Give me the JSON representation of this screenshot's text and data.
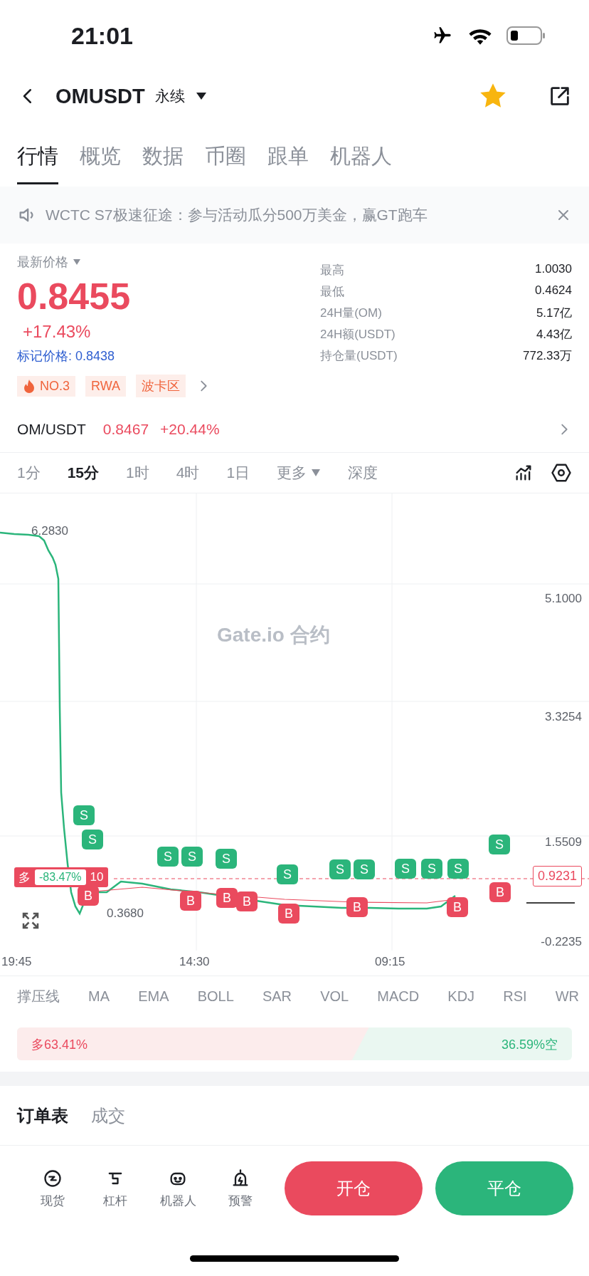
{
  "status_bar": {
    "time": "21:01"
  },
  "header": {
    "symbol": "OMUSDT",
    "contract_type": "永续",
    "favorite": true
  },
  "tabs": [
    {
      "label": "行情",
      "selected": true
    },
    {
      "label": "概览",
      "selected": false
    },
    {
      "label": "数据",
      "selected": false
    },
    {
      "label": "币圈",
      "selected": false
    },
    {
      "label": "跟单",
      "selected": false
    },
    {
      "label": "机器人",
      "selected": false
    }
  ],
  "announcement": {
    "text": "WCTC S7极速征途：参与活动瓜分500万美金，赢GT跑车"
  },
  "price": {
    "label": "最新价格",
    "value": "0.8455",
    "change": "+17.43%",
    "mark_price": "标记价格: 0.8438"
  },
  "tags": [
    {
      "kind": "hot",
      "label": "NO.3"
    },
    {
      "kind": "plain",
      "label": "RWA"
    },
    {
      "kind": "plain",
      "label": "波卡区"
    }
  ],
  "stats": [
    {
      "label": "最高",
      "value": "1.0030"
    },
    {
      "label": "最低",
      "value": "0.4624"
    },
    {
      "label": "24H量(OM)",
      "value": "5.17亿"
    },
    {
      "label": "24H额(USDT)",
      "value": "4.43亿"
    },
    {
      "label": "持仓量(USDT)",
      "value": "772.33万"
    }
  ],
  "spot": {
    "pair": "OM/USDT",
    "price": "0.8467",
    "change": "+20.44%"
  },
  "timeframes": [
    {
      "label": "1分",
      "selected": false
    },
    {
      "label": "15分",
      "selected": true
    },
    {
      "label": "1时",
      "selected": false
    },
    {
      "label": "4时",
      "selected": false
    },
    {
      "label": "1日",
      "selected": false
    }
  ],
  "more": "更多",
  "depth": "深度",
  "chart": {
    "y_labels": [
      "5.1000",
      "3.3254",
      "1.5509",
      "-0.2235"
    ],
    "x_labels": [
      "19:45",
      "14:30",
      "09:15"
    ],
    "high_label": "6.2830",
    "low_label": "0.3680",
    "last_price": "0.9231",
    "watermark": "Gate.io 合约",
    "position": {
      "side": "多",
      "pnl": "-83.47%",
      "leverage": "10"
    },
    "markers": [
      {
        "kind": "sell",
        "label": "S"
      },
      {
        "kind": "sell",
        "label": "S"
      },
      {
        "kind": "sell",
        "label": "S"
      },
      {
        "kind": "sell",
        "label": "S"
      },
      {
        "kind": "sell",
        "label": "S"
      },
      {
        "kind": "sell",
        "label": "S"
      },
      {
        "kind": "sell",
        "label": "S"
      },
      {
        "kind": "sell",
        "label": "S"
      },
      {
        "kind": "sell",
        "label": "S"
      },
      {
        "kind": "sell",
        "label": "S"
      },
      {
        "kind": "sell",
        "label": "S"
      },
      {
        "kind": "sell",
        "label": "S"
      },
      {
        "kind": "buy",
        "label": "B"
      },
      {
        "kind": "buy",
        "label": "B"
      },
      {
        "kind": "buy",
        "label": "B"
      },
      {
        "kind": "buy",
        "label": "B"
      },
      {
        "kind": "buy",
        "label": "B"
      },
      {
        "kind": "buy",
        "label": "B"
      },
      {
        "kind": "buy",
        "label": "B"
      },
      {
        "kind": "buy",
        "label": "B"
      }
    ]
  },
  "indicators": [
    "撑压线",
    "MA",
    "EMA",
    "BOLL",
    "SAR",
    "VOL",
    "MACD",
    "KDJ",
    "RSI",
    "WR"
  ],
  "ratio": {
    "long_label": "多63.41%",
    "short_label": "36.59%空",
    "level": 0.6341
  },
  "order_tabs": [
    {
      "label": "订单表",
      "selected": true
    },
    {
      "label": "成交",
      "selected": false
    }
  ],
  "nav": [
    {
      "kind": "spot",
      "label": "现货"
    },
    {
      "kind": "margin",
      "label": "杠杆"
    },
    {
      "kind": "robot",
      "label": "机器人"
    },
    {
      "kind": "alert",
      "label": "预警"
    }
  ],
  "buttons": {
    "open": "开仓",
    "close": "平仓"
  }
}
